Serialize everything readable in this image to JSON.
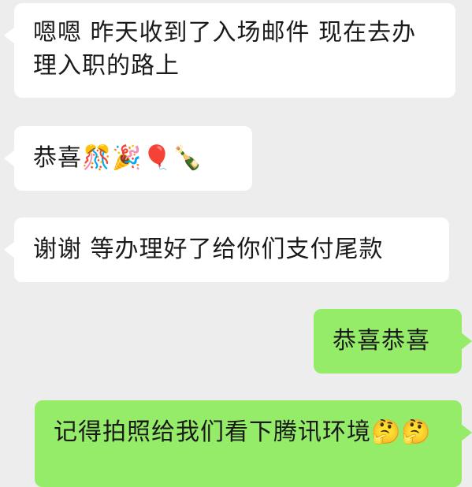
{
  "chat": {
    "background": "#ededed",
    "incoming_color": "#ffffff",
    "outgoing_color": "#95ec69",
    "messages": [
      {
        "direction": "incoming",
        "text": "嗯嗯 昨天收到了入场邮件  现在去办理入职的路上"
      },
      {
        "direction": "incoming",
        "text": "恭喜🎊🎉🎈🍾"
      },
      {
        "direction": "incoming",
        "text": "谢谢 等办理好了给你们支付尾款"
      },
      {
        "direction": "outgoing",
        "text": "恭喜恭喜"
      },
      {
        "direction": "outgoing",
        "text": "记得拍照给我们看下腾讯环境🤔🤔"
      }
    ]
  }
}
